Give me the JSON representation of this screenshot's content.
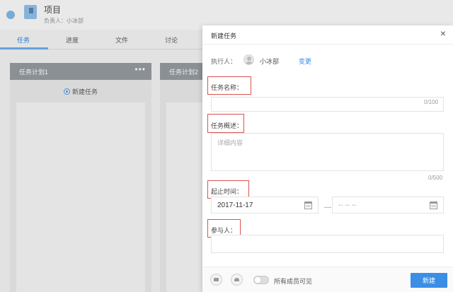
{
  "project": {
    "title": "项目",
    "owner": "负责人：小冰部"
  },
  "tabs": [
    {
      "label": "任务",
      "active": true
    },
    {
      "label": "进度",
      "active": false
    },
    {
      "label": "文件",
      "active": false
    },
    {
      "label": "讨论",
      "active": false
    }
  ],
  "columns": [
    {
      "title": "任务计划1",
      "more": "•••",
      "new_task": "新建任务"
    },
    {
      "title": "任务计划2"
    }
  ],
  "dialog": {
    "title": "新建任务",
    "close": "×",
    "executor": {
      "label": "执行人：",
      "name": "小冰部",
      "change": "变更"
    },
    "task_name": {
      "label": "任务名称：",
      "value": "",
      "counter": "0/100"
    },
    "task_desc": {
      "label": "任务概述：",
      "placeholder": "详细内容",
      "counter": "0/500"
    },
    "time": {
      "label": "起止时间：",
      "start": "2017-11-17",
      "dash": "—",
      "end_placeholder": "-- -- --"
    },
    "participants": {
      "label": "参与人："
    },
    "footer": {
      "visibility_label": "所有成员可见",
      "create_button": "新建"
    }
  },
  "colors": {
    "accent": "#3a8ee6",
    "highlight_box": "#d9534f"
  },
  "icons": [
    "close-icon",
    "avatar-icon",
    "calendar-icon",
    "folder-icon",
    "upload-icon",
    "toggle-switch"
  ]
}
